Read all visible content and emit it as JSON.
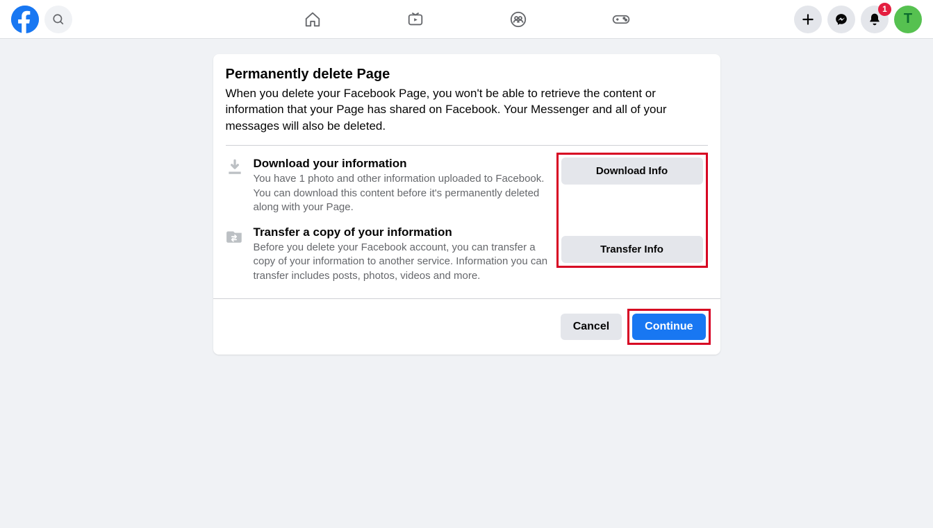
{
  "nav": {
    "notification_badge": "1",
    "avatar_initial": "T"
  },
  "dialog": {
    "title": "Permanently delete Page",
    "description": "When you delete your Facebook Page, you won't be able to retrieve the content or information that your Page has shared on Facebook. Your Messenger and all of your messages will also be deleted.",
    "options": [
      {
        "title": "Download your information",
        "description": "You have 1 photo and other information uploaded to Facebook. You can download this content before it's permanently deleted along with your Page.",
        "button_label": "Download Info"
      },
      {
        "title": "Transfer a copy of your information",
        "description": "Before you delete your Facebook account, you can transfer a copy of your information to another service. Information you can transfer includes posts, photos, videos and more.",
        "button_label": "Transfer Info"
      }
    ],
    "cancel_label": "Cancel",
    "continue_label": "Continue"
  }
}
